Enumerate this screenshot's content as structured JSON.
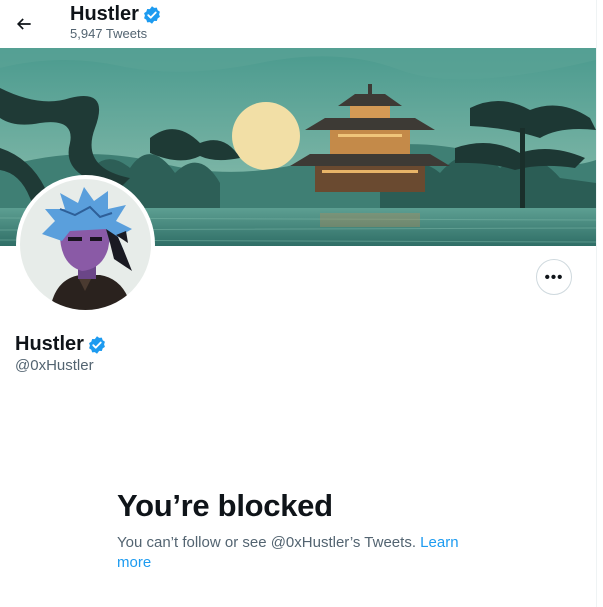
{
  "header": {
    "name": "Hustler",
    "tweet_count": "5,947 Tweets"
  },
  "icons": {
    "back": "arrow-left-icon",
    "verified": "verified-badge-icon",
    "more": "more-horizontal-icon"
  },
  "profile": {
    "name": "Hustler",
    "handle": "@0xHustler",
    "more_label": "•••"
  },
  "blocked": {
    "title": "You’re blocked",
    "message": "You can’t follow or see @0xHustler’s Tweets.",
    "link": "Learn more"
  },
  "colors": {
    "accent": "#1d9bf0",
    "text_primary": "#0f1419",
    "text_secondary": "#536471",
    "banner_teal": "#3f8c80",
    "avatar_skin": "#8a5aa6"
  }
}
